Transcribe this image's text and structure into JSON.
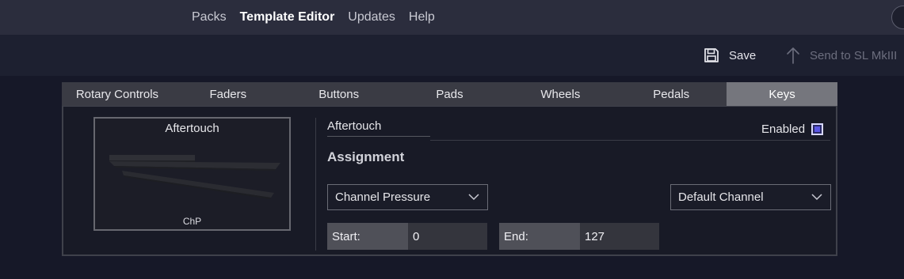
{
  "nav": {
    "items": [
      "Packs",
      "Template Editor",
      "Updates",
      "Help"
    ],
    "active": "Template Editor"
  },
  "actions": {
    "save_label": "Save",
    "send_label": "Send to SL MkIII"
  },
  "tabs": [
    "Rotary Controls",
    "Faders",
    "Buttons",
    "Pads",
    "Wheels",
    "Pedals",
    "Keys"
  ],
  "active_tab": "Keys",
  "preview": {
    "title": "Aftertouch",
    "label": "ChP"
  },
  "control": {
    "name": "Aftertouch",
    "enabled_label": "Enabled",
    "enabled": true
  },
  "assignment": {
    "heading": "Assignment",
    "type_value": "Channel Pressure",
    "channel_value": "Default Channel",
    "start_label": "Start:",
    "start_value": "0",
    "end_label": "End:",
    "end_value": "127"
  },
  "colors": {
    "accent": "#5b57e3",
    "active_tab": "#75767d"
  }
}
